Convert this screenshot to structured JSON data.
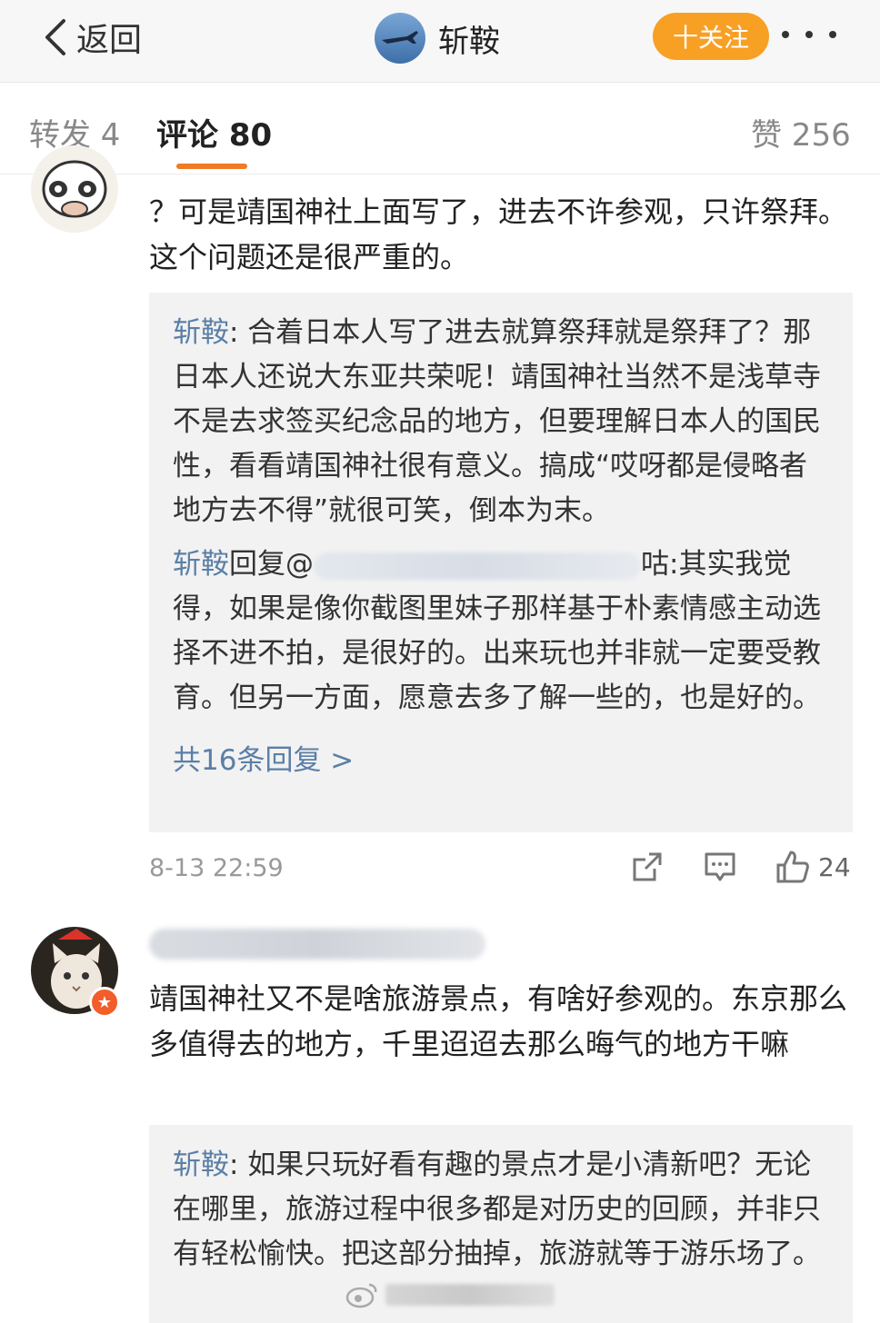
{
  "header": {
    "back_label": "返回",
    "title": "斩鞍",
    "follow_label": "十关注"
  },
  "tabs": {
    "repost": "转发 4",
    "comments": "评论 80",
    "likes": "赞 256"
  },
  "comment1": {
    "text": "？可是靖国神社上面写了，进去不许参观，只许祭拜。这个问题还是很严重的。",
    "reply1": {
      "name": "斩鞍",
      "text": ": 合着日本人写了进去就算祭拜就是祭拜了？那日本人还说大东亚共荣呢！靖国神社当然不是浅草寺不是去求签买纪念品的地方，但要理解日本人的国民性，看看靖国神社很有意义。搞成“哎呀都是侵略者地方去不得”就很可笑，倒本为末。"
    },
    "reply2": {
      "name": "斩鞍",
      "prefix": "回复@",
      "handle_end": "咕",
      "text": ":其实我觉得，如果是像你截图里妹子那样基于朴素情感主动选择不进不拍，是很好的。出来玩也并非就一定要受教育。但另一方面，愿意去多了解一些的，也是好的。"
    },
    "more_replies": "共16条回复 >",
    "time": "8-13 22:59",
    "like_count": "24"
  },
  "comment2": {
    "text": "靖国神社又不是啥旅游景点，有啥好参观的。东京那么多值得去的地方，千里迢迢去那么晦气的地方干嘛",
    "reply1": {
      "name": "斩鞍",
      "text": ": 如果只玩好看有趣的景点才是小清新吧？无论在哪里，旅游过程中很多都是对历史的回顾，并非只有轻松愉快。把这部分抽掉，旅游就等于游乐场了。"
    }
  },
  "colors": {
    "accent": "#f8a024",
    "tab_underline": "#f07b22",
    "link": "#5b7fa6",
    "reply_bg": "#f2f2f2"
  }
}
